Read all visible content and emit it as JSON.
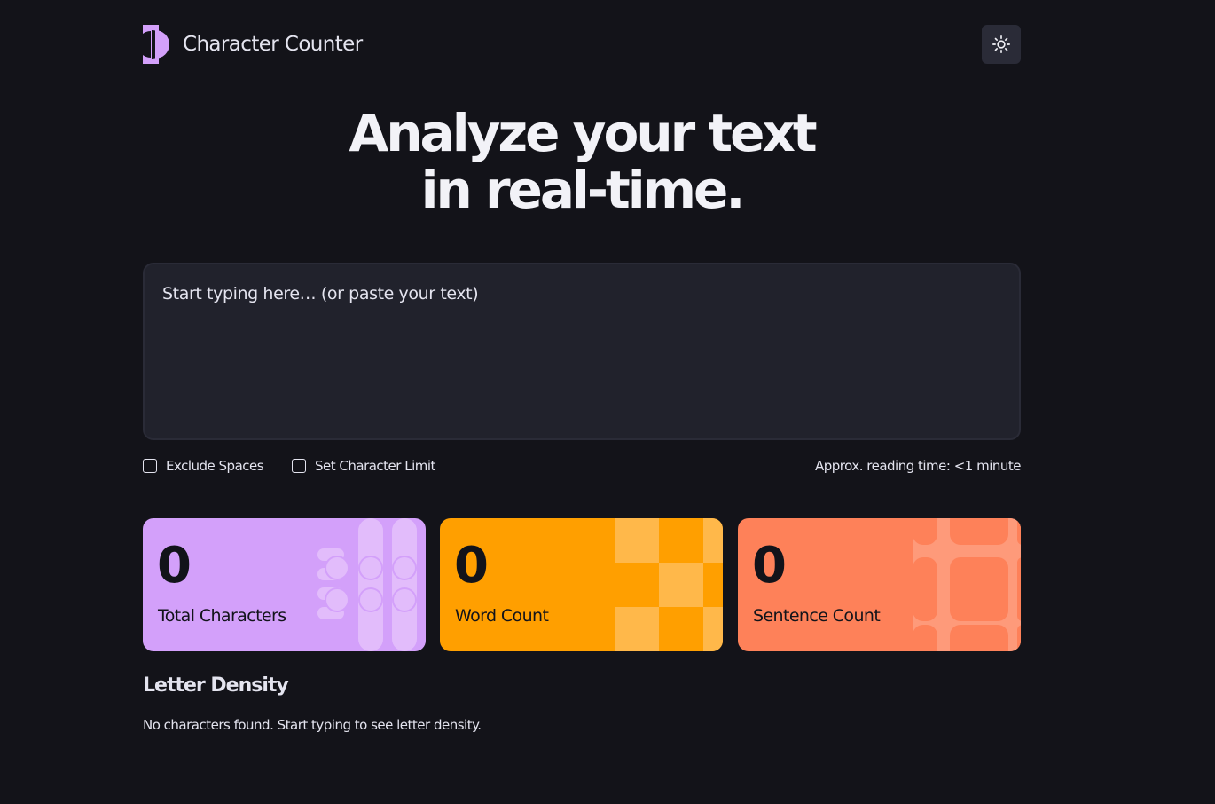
{
  "header": {
    "app_title": "Character Counter",
    "logo_icon": "half-circle-logo-icon",
    "theme_toggle_icon": "sun-icon",
    "accent_color": "#d3a0fa"
  },
  "hero": {
    "line1": "Analyze your text",
    "line2": "in real-time."
  },
  "editor": {
    "placeholder": "Start typing here… (or paste your text)",
    "value": ""
  },
  "options": {
    "exclude_spaces_label": "Exclude Spaces",
    "exclude_spaces_checked": false,
    "character_limit_label": "Set Character Limit",
    "character_limit_checked": false,
    "reading_time": "Approx. reading time: <1 minute"
  },
  "stats": [
    {
      "value": "0",
      "label": "Total Characters",
      "color": "#d3a0fa"
    },
    {
      "value": "0",
      "label": "Word Count",
      "color": "#ff9f00"
    },
    {
      "value": "0",
      "label": "Sentence Count",
      "color": "#fe8159"
    }
  ],
  "letter_density": {
    "title": "Letter Density",
    "empty_message": "No characters found. Start typing to see letter density."
  }
}
